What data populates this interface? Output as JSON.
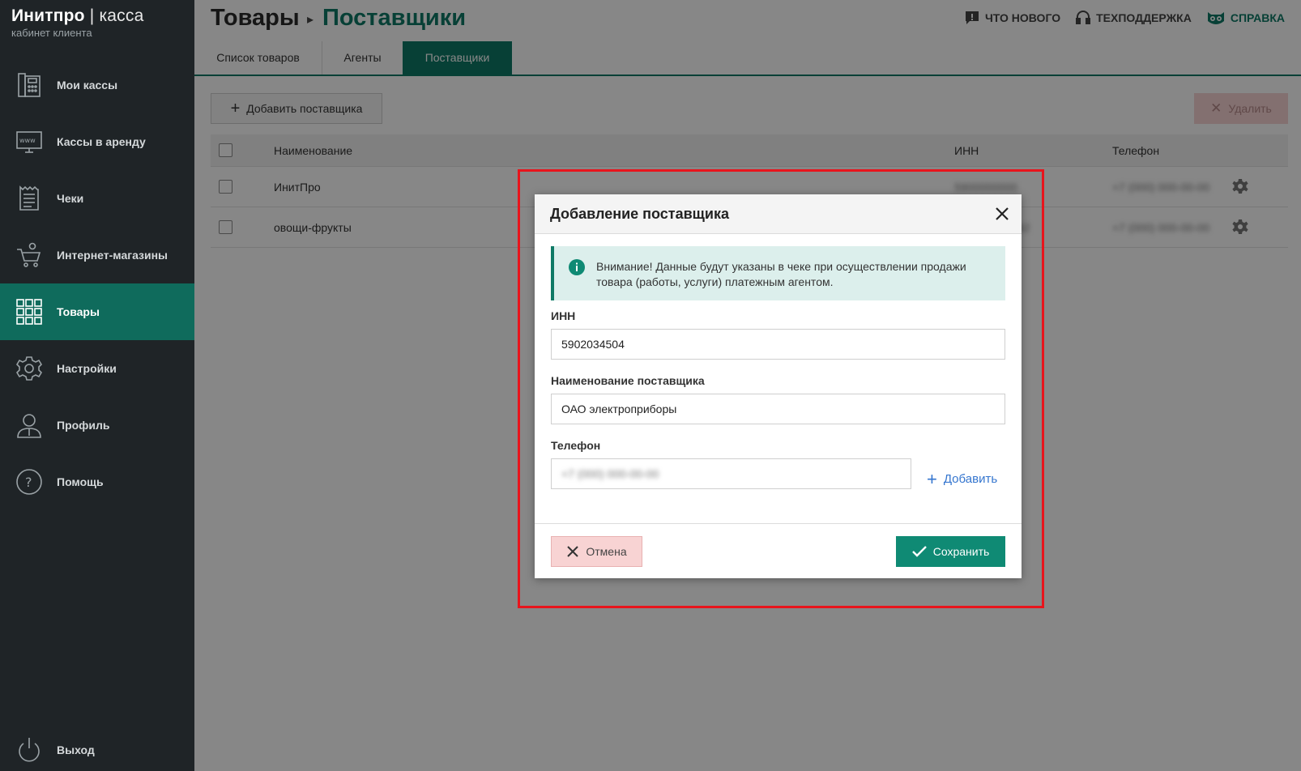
{
  "brand": {
    "name_bold": "Инитпро",
    "name_sep": " | ",
    "name_light": "касса",
    "subtitle": "кабинет клиента"
  },
  "sidebar": {
    "items": [
      {
        "label": "Мои кассы",
        "icon": "cash-register-icon"
      },
      {
        "label": "Кассы в аренду",
        "icon": "www-monitor-icon"
      },
      {
        "label": "Чеки",
        "icon": "receipt-icon"
      },
      {
        "label": "Интернет-магазины",
        "icon": "shopping-cart-icon"
      },
      {
        "label": "Товары",
        "icon": "grid-icon",
        "active": true
      },
      {
        "label": "Настройки",
        "icon": "gear-icon"
      },
      {
        "label": "Профиль",
        "icon": "user-icon"
      },
      {
        "label": "Помощь",
        "icon": "help-icon"
      }
    ],
    "logout": "Выход"
  },
  "header": {
    "crumb_root": "Товары",
    "crumb_current": "Поставщики",
    "links": {
      "whats_new": "Что нового",
      "support": "Техподдержка",
      "help": "Справка"
    }
  },
  "tabs": [
    "Список товаров",
    "Агенты",
    "Поставщики"
  ],
  "toolbar": {
    "add_label": "Добавить поставщика",
    "delete_label": "Удалить"
  },
  "table": {
    "columns": [
      "Наименование",
      "ИНН",
      "Телефон"
    ],
    "rows": [
      {
        "name": "ИнитПро",
        "inn": "5900000000",
        "phone": "+7 (000) 000-00-00"
      },
      {
        "name": "овощи-фрукты",
        "inn": "590000000042",
        "phone": "+7 (000) 000-00-00"
      }
    ]
  },
  "modal": {
    "title": "Добавление поставщика",
    "alert": "Внимание! Данные будут указаны в чеке при осуществлении продажи товара (работы, услуги) платежным агентом.",
    "inn_label": "ИНН",
    "inn_value": "5902034504",
    "name_label": "Наименование поставщика",
    "name_value": "ОАО электроприборы",
    "phone_label": "Телефон",
    "phone_value": "+7 (000) 000-00-00",
    "add_label": "Добавить",
    "cancel_label": "Отмена",
    "save_label": "Сохранить"
  },
  "colors": {
    "accent": "#0f7a66",
    "sidebar_bg": "#1f2427",
    "highlight": "#e8141c",
    "danger_bg": "#f8d3d3",
    "link": "#3576cf"
  }
}
